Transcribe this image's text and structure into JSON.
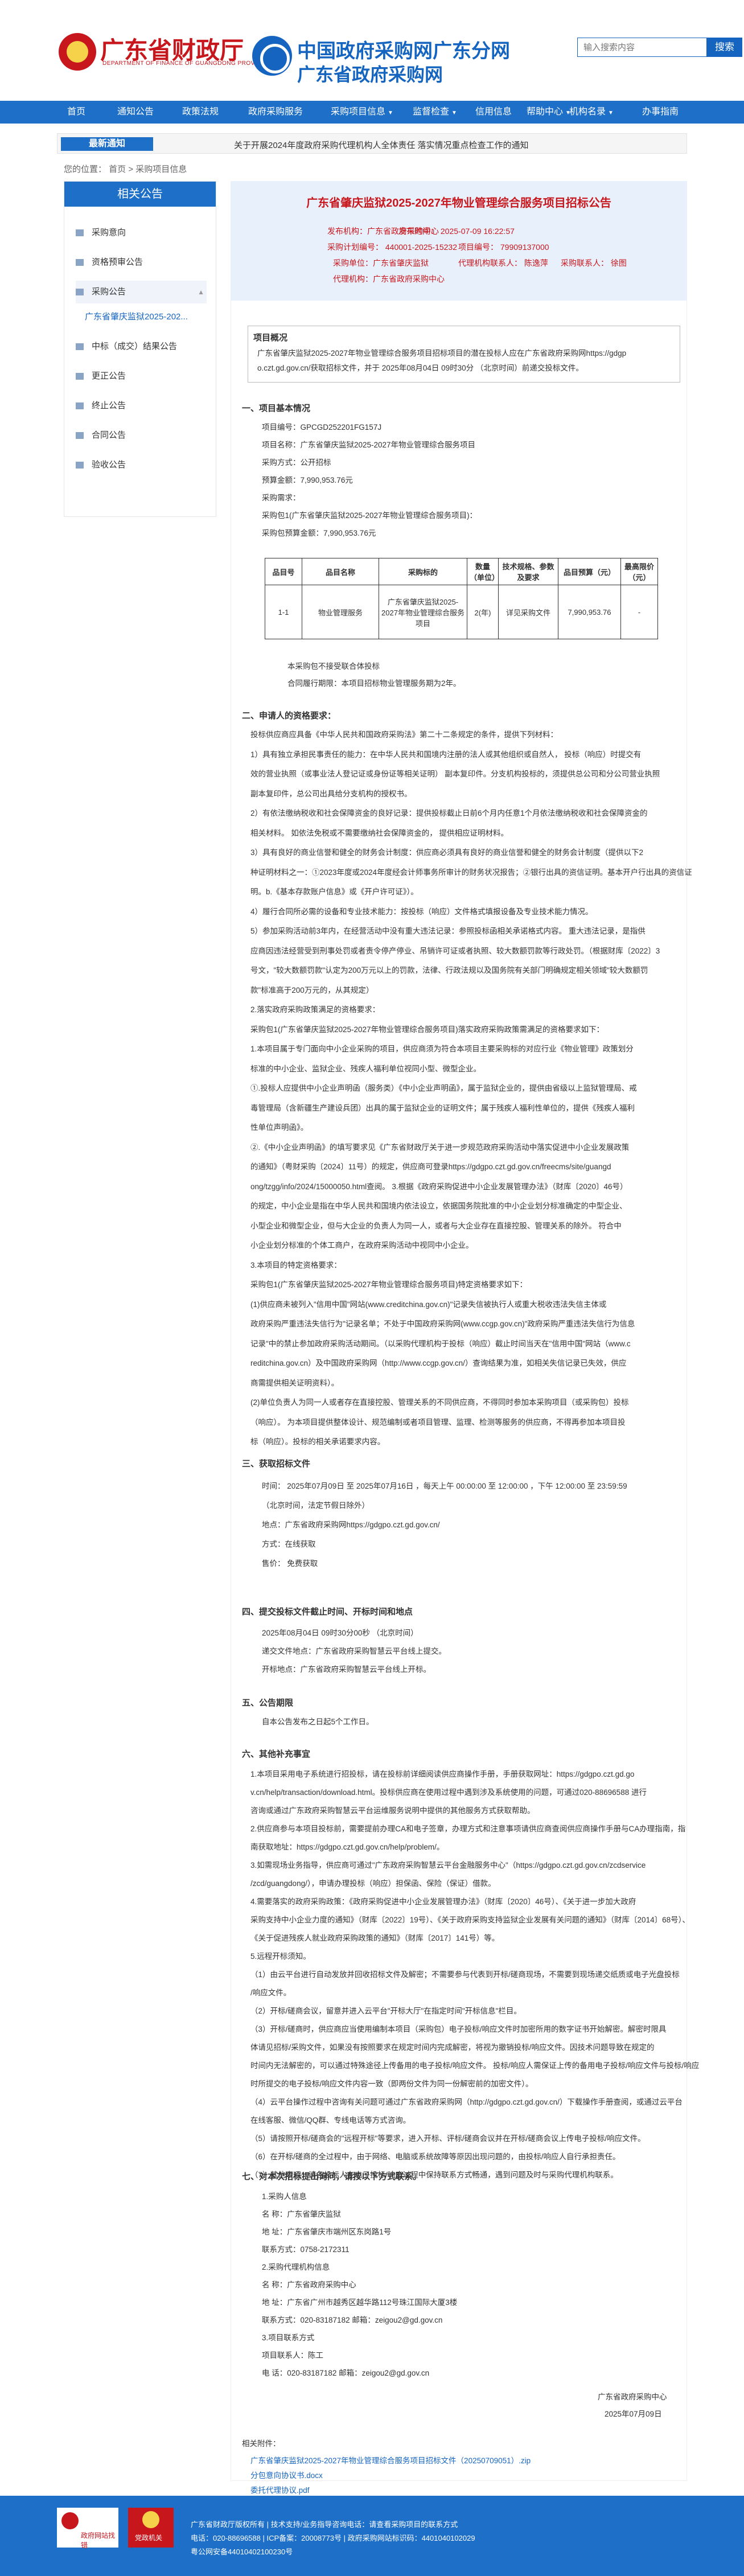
{
  "header": {
    "logo_left_title": "广东省财政厅",
    "logo_left_sub": "DEPARTMENT OF FINANCE OF GUANGDONG PROVINCE",
    "logo_mid_title1": "中国政府采购网广东分网",
    "logo_mid_title2": "广东省政府采购网",
    "search_placeholder": "输入搜索内容",
    "search_button": "搜索"
  },
  "nav": [
    {
      "label": "首页",
      "arrow": ""
    },
    {
      "label": "通知公告",
      "arrow": ""
    },
    {
      "label": "政策法规",
      "arrow": ""
    },
    {
      "label": "政府采购服务",
      "arrow": ""
    },
    {
      "label": "采购项目信息",
      "arrow": "▼"
    },
    {
      "label": "监督检查",
      "arrow": "▼"
    },
    {
      "label": "信用信息",
      "arrow": ""
    },
    {
      "label": "帮助中心",
      "arrow": "▼"
    },
    {
      "label": "机构名录",
      "arrow": "▼"
    },
    {
      "label": "办事指南",
      "arrow": ""
    }
  ],
  "notice": {
    "badge": "最新通知",
    "text": "关于开展2024年度政府采购代理机构人全体责任 落实情况重点检查工作的通知"
  },
  "breadcrumb": "您的位置：  首页  >  采购项目信息",
  "sidebar": {
    "title": "相关公告",
    "items": [
      "采购意向",
      "资格预审公告",
      "采购公告",
      "中标（成交）结果公告",
      "更正公告",
      "终止公告",
      "合同公告",
      "验收公告"
    ],
    "sub": "广东省肇庆监狱2025-202..."
  },
  "article": {
    "title": "广东省肇庆监狱2025-2027年物业管理综合服务项目招标公告",
    "publish_time": "发布时间：  2025-07-09 16:22:57",
    "publisher": "发布机构：广东省政府采购中心",
    "plan_no": "采购计划编号：  440001-2025-15232",
    "project_no": "项目编号：  79909137000",
    "buyer": "采购单位：广东省肇庆监狱",
    "agent": "代理机构：广东省政府采购中心",
    "agent_contact": "代理机构联系人：  陈逸萍",
    "buyer_contact": "采购联系人：  徐图"
  },
  "overview": {
    "title": "项目概况",
    "line1": "广东省肇庆监狱2025-2027年物业管理综合服务项目招标项目的潜在投标人应在广东省政府采购网https://gdgp",
    "line2": "o.czt.gd.gov.cn/获取招标文件，并于  2025年08月04日 09时30分  （北京时间）前递交投标文件。"
  },
  "s1": {
    "title": "一、项目基本情况",
    "lines": [
      "项目编号：GPCGD252201FG157J",
      "项目名称：广东省肇庆监狱2025-2027年物业管理综合服务项目",
      "采购方式：公开招标",
      "预算金额：7,990,953.76元",
      "采购需求：",
      "采购包1(广东省肇庆监狱2025-2027年物业管理综合服务项目)：",
      "采购包预算金额：7,990,953.76元"
    ],
    "after": [
      "本采购包不接受联合体投标",
      "合同履行期限：本项目招标物业管理服务期为2年。"
    ]
  },
  "table": {
    "headers": [
      "品目号",
      "品目名称",
      "采购标的",
      "数量（单位）",
      "技术规格、参数及要求",
      "品目预算（元）",
      "最高限价（元）"
    ],
    "row": [
      "1-1",
      "物业管理服务",
      "广东省肇庆监狱2025-2027年物业管理综合服务项目",
      "2(年)",
      "详见采购文件",
      "7,990,953.76",
      "-"
    ]
  },
  "s2": {
    "title": "二、申请人的资格要求：",
    "lines": [
      "投标供应商应具备《中华人民共和国政府采购法》第二十二条规定的条件，提供下列材料：",
      "1）具有独立承担民事责任的能力：在中华人民共和国境内注册的法人或其他组织或自然人， 投标（响应）时提交有",
      "效的营业执照（或事业法人登记证或身份证等相关证明） 副本复印件。分支机构投标的，须提供总公司和分公司营业执照",
      "副本复印件，总公司出具给分支机构的授权书。",
      "2）有依法缴纳税收和社会保障资金的良好记录：提供投标截止日前6个月内任意1个月依法缴纳税收和社会保障资金的",
      "相关材料。 如依法免税或不需要缴纳社会保障资金的， 提供相应证明材料。",
      "3）具有良好的商业信誉和健全的财务会计制度：供应商必须具有良好的商业信誉和健全的财务会计制度（提供以下2",
      "种证明材料之一：①2023年度或2024年度经会计师事务所审计的财务状况报告；②银行出具的资信证明。基本开户行出具的资信证",
      "明。b.《基本存款账户信息》或《开户许可证》）。",
      "4）履行合同所必需的设备和专业技术能力：按投标（响应）文件格式填报设备及专业技术能力情况。",
      "5）参加采购活动前3年内，在经营活动中没有重大违法记录：参照投标函相关承诺格式内容。 重大违法记录，是指供",
      "应商因违法经营受到刑事处罚或者责令停产停业、吊销许可证或者执照、较大数额罚款等行政处罚。（根据财库〔2022〕3",
      "号文，\"较大数额罚款\"认定为200万元以上的罚款，法律、行政法规以及国务院有关部门明确规定相关领域\"较大数额罚",
      "款\"标准高于200万元的，从其规定）",
      "2.落实政府采购政策满足的资格要求：",
      "采购包1(广东省肇庆监狱2025-2027年物业管理综合服务项目)落实政府采购政策需满足的资格要求如下：",
      "1.本项目属于专门面向中小企业采购的项目，供应商须为符合本项目主要采购标的对应行业《物业管理》政策划分",
      "标准的中小企业、监狱企业、残疾人福利单位视同小型、微型企业。",
      "①.投标人应提供中小企业声明函（服务类）《中小企业声明函》，属于监狱企业的，提供由省级以上监狱管理局、戒",
      "毒管理局（含新疆生产建设兵团）出具的属于监狱企业的证明文件；属于残疾人福利性单位的，提供《残疾人福利",
      "性单位声明函》。",
      "②.《中小企业声明函》的填写要求见《广东省财政厅关于进一步规范政府采购活动中落实促进中小企业发展政策",
      "的通知》（粤财采购〔2024〕11号）的规定，供应商可登录https://gdgpo.czt.gd.gov.cn/freecms/site/guangd",
      "ong/tzgg/info/2024/15000050.html查阅。 3.根据《政府采购促进中小企业发展管理办法》（财库〔2020〕46号）",
      "的规定，中小企业是指在中华人民共和国境内依法设立，依据国务院批准的中小企业划分标准确定的中型企业、",
      "小型企业和微型企业，但与大企业的负责人为同一人，或者与大企业存在直接控股、管理关系的除外。 符合中",
      "小企业划分标准的个体工商户，在政府采购活动中视同中小企业。",
      "3.本项目的特定资格要求：",
      "采购包1(广东省肇庆监狱2025-2027年物业管理综合服务项目)特定资格要求如下：",
      "(1)供应商未被列入\"信用中国\"网站(www.creditchina.gov.cn)\"记录失信被执行人或重大税收违法失信主体或",
      "政府采购严重违法失信行为\"记录名单；不处于中国政府采购网(www.ccgp.gov.cn)\"政府采购严重违法失信行为信息",
      "记录\"中的禁止参加政府采购活动期间。（以采购代理机构于投标（响应）截止时间当天在\"信用中国\"网站（www.c",
      "reditchina.gov.cn）及中国政府采购网（http://www.ccgp.gov.cn/）查询结果为准，如相关失信记录已失效，供应",
      "商需提供相关证明资料）。",
      "(2)单位负责人为同一人或者存在直接控股、管理关系的不同供应商，不得同时参加本采购项目（或采购包）投标",
      "（响应）。 为本项目提供整体设计、规范编制或者项目管理、监理、检测等服务的供应商，不得再参加本项目投",
      "标（响应）。投标的相关承诺要求内容。"
    ]
  },
  "s3": {
    "title": "三、获取招标文件",
    "lines": [
      "时间：  2025年07月09日  至  2025年07月16日  ，每天上午  00:00:00  至  12:00:00  ，下午  12:00:00  至  23:59:59",
      "（北京时间，法定节假日除外）",
      "地点：广东省政府采购网https://gdgpo.czt.gd.gov.cn/",
      "方式：在线获取",
      "售价：  免费获取"
    ]
  },
  "s4": {
    "title": "四、提交投标文件截止时间、开标时间和地点",
    "lines": [
      "2025年08月04日 09时30分00秒  （北京时间）",
      "递交文件地点：广东省政府采购智慧云平台线上提交。",
      "开标地点：广东省政府采购智慧云平台线上开标。"
    ]
  },
  "s5": {
    "title": "五、公告期限",
    "line": "自本公告发布之日起5个工作日。"
  },
  "s6": {
    "title": "六、其他补充事宜",
    "lines": [
      "1.本项目采用电子系统进行招投标，请在投标前详细阅读供应商操作手册，手册获取网址：https://gdgpo.czt.gd.go",
      "v.cn/help/transaction/download.html。投标供应商在使用过程中遇到涉及系统使用的问题，可通过020-88696588 进行",
      "咨询或通过广东政府采购智慧云平台运维服务说明中提供的其他服务方式获取帮助。",
      "2.供应商参与本项目投标前，需要提前办理CA和电子签章，办理方式和注意事项请供应商查阅供应商操作手册与CA办理指南，指",
      "南获取地址：https://gdgpo.czt.gd.gov.cn/help/problem/。",
      "3.如需现场业务指导，供应商可通过\"广东政府采购智慧云平台金融服务中心\"（https://gdgpo.czt.gd.gov.cn/zcdservice",
      "/zcd/guangdong/），申请办理投标（响应）担保函、保险（保证）借款。",
      "4.需要落实的政府采购政策：《政府采购促进中小企业发展管理办法》（财库〔2020〕46号）、《关于进一步加大政府",
      "采购支持中小企业力度的通知》（财库〔2022〕19号）、《关于政府采购支持监狱企业发展有关问题的通知》（财库〔2014〕68号）、",
      "《关于促进残疾人就业政府采购政策的通知》（财库〔2017〕141号）等。",
      "5.远程开标须知。",
      "（1）由云平台进行自动发放并回收招标文件及解密；不需要参与代表到开标/磋商现场，不需要到现场递交纸质或电子光盘投标",
      "/响应文件。",
      "（2）开标/磋商会议，留意并进入云平台\"开标大厅\"在指定时间\"开标信息\"栏目。",
      "（3）开标/磋商时，供应商应当使用编制本项目（采购包）电子投标/响应文件时加密所用的数字证书开始解密。解密时限具",
      "体请见招标/采购文件，如果没有按照要求在规定时间内完成解密，将视为撤销投标/响应文件。因技术问题导致在规定的",
      "时间内无法解密的，可以通过特殊途径上传备用的电子投标/响应文件。 投标/响应人需保证上传的备用电子投标/响应文件与投标/响应",
      "时所提交的电子投标/响应文件内容一致（即两份文件为同一份解密前的加密文件）。",
      "（4）云平台操作过程中咨询有关问题可通过广东省政府采购网（http://gdgpo.czt.gd.gov.cn/）下载操作手册查阅，或通过云平台",
      "在线客服、微信/QQ群、专线电话等方式咨询。",
      "（5）请按照开标/磋商会的\"远程开标\"等要求，进入开标、评标/磋商会议并在开标/磋商会议上传电子投标/响应文件。",
      "（6）在开标/磋商的全过程中，由于网络、电脑或系统故障等原因出现问题的，由投标/响应人自行承担责任。",
      "（7）其他事项：请各投标人在电子投标/响应过程中保持联系方式畅通，遇到问题及时与采购代理机构联系。"
    ]
  },
  "s7": {
    "title": "七、对本次招标提出询问，请按以下方式联系。",
    "lines": [
      "1.采购人信息",
      "名   称：广东省肇庆监狱",
      "地   址：广东省肇庆市端州区东岗路1号",
      "联系方式：0758-2172311",
      "2.采购代理机构信息",
      "名   称：广东省政府采购中心",
      "地   址：广东省广州市越秀区越华路112号珠江国际大厦3楼",
      "联系方式：020-83187182 邮箱：zeigou2@gd.gov.cn",
      "3.项目联系方式",
      "项目联系人：陈工",
      "电   话：020-83187182 邮箱：zeigou2@gd.gov.cn"
    ],
    "sign1": "广东省政府采购中心",
    "sign2": "2025年07月09日"
  },
  "attachments": {
    "title": "相关附件：",
    "files": [
      "广东省肇庆监狱2025-2027年物业管理综合服务项目招标文件（20250709051）.zip",
      "分包意向协议书.docx",
      "委托代理协议.pdf"
    ]
  },
  "footer": {
    "line1": "广东省财政厅版权所有 | 技术支持/业务指导咨询电话：请查看采购项目的联系方式",
    "line2": "电话：020-88696588 | ICP备案：20008773号 | 政府采购网站标识码：4401040102029",
    "line3": "粤公网安备44010402100230号",
    "badge1": "政府网站找错",
    "badge2": "党政机关"
  },
  "colors": {
    "brand": "#1e6fc8",
    "title_red": "#c8161d"
  }
}
